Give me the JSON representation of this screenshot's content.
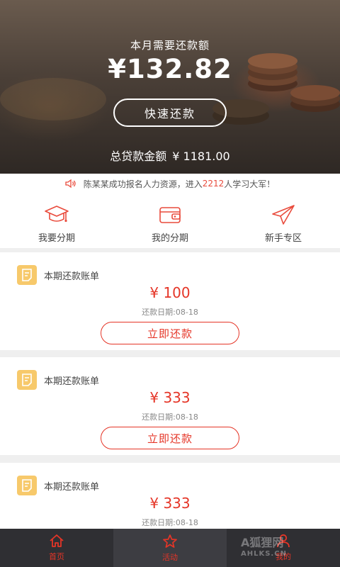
{
  "hero": {
    "label": "本月需要还款额",
    "amount": "¥132.82",
    "quick_button": "快速还款",
    "total_prefix": "总贷款金额",
    "total_value": "¥ 1181.00"
  },
  "notice": {
    "before": "陈某某成功报名人力资源，进入",
    "highlight": "2212",
    "after": "人学习大军！"
  },
  "nav": [
    {
      "label": "我要分期",
      "icon": "graduation-cap-icon"
    },
    {
      "label": "我的分期",
      "icon": "wallet-icon"
    },
    {
      "label": "新手专区",
      "icon": "paper-plane-icon"
    }
  ],
  "bills": [
    {
      "title": "本期还款账单",
      "amount": "¥ 100",
      "date": "还款日期:08-18",
      "pay_label": "立即还款"
    },
    {
      "title": "本期还款账单",
      "amount": "¥ 333",
      "date": "还款日期:08-18",
      "pay_label": "立即还款"
    },
    {
      "title": "本期还款账单",
      "amount": "¥ 333",
      "date": "还款日期:08-18",
      "pay_label": "立即还款"
    }
  ],
  "tabs": [
    {
      "label": "首页",
      "icon": "home-icon"
    },
    {
      "label": "活动",
      "icon": "star-icon"
    },
    {
      "label": "我的",
      "icon": "user-icon"
    }
  ],
  "watermark": {
    "line1": "A狐狸网",
    "line2": "AHLKS.CN"
  },
  "colors": {
    "accent": "#e53527",
    "bill_icon": "#f7c96b",
    "tabbar": "#2f2f33"
  }
}
